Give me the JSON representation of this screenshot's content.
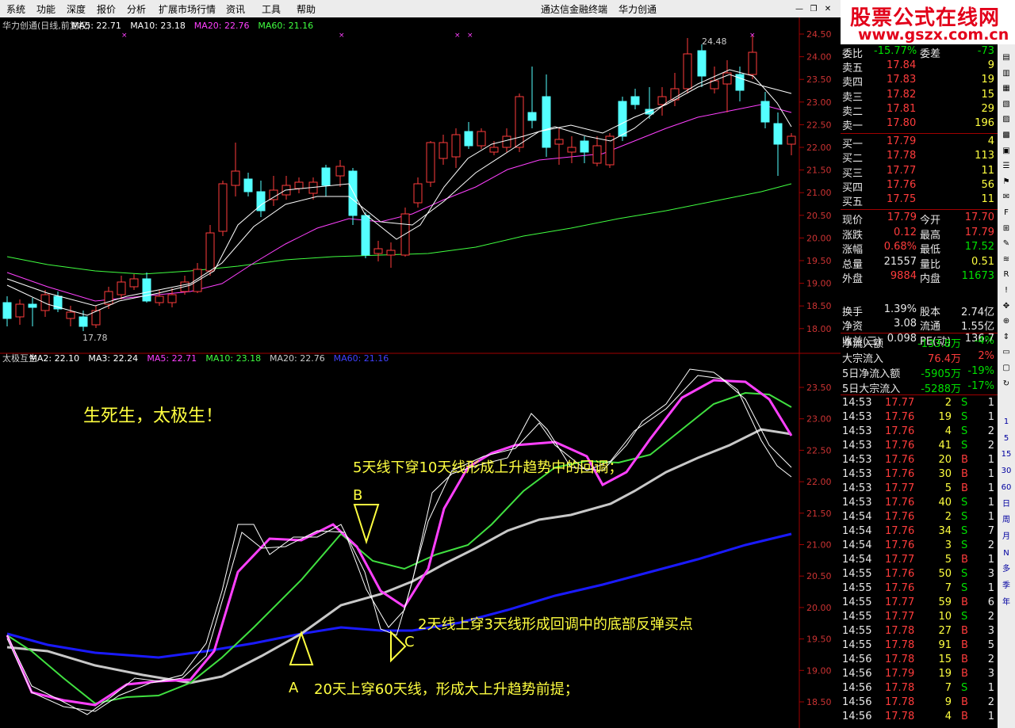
{
  "menu": {
    "items": [
      "系统",
      "功能",
      "深度",
      "报价",
      "分析",
      "扩展市场行情",
      "资讯",
      "工具",
      "帮助"
    ],
    "center_title": "通达信金融终端",
    "stock_name": "华力创通"
  },
  "brand": {
    "line1": "股票公式在线网",
    "line2": "www.gszx.com.cn"
  },
  "upper_chart": {
    "legend": [
      {
        "text": "华力创通(日线,前复权)",
        "color": "#d0d0d0"
      },
      {
        "text": "MA5: 22.71",
        "color": "#ffffff"
      },
      {
        "text": "MA10: 23.18",
        "color": "#ffffff"
      },
      {
        "text": "MA20: 22.76",
        "color": "#ff40ff"
      },
      {
        "text": "MA60: 21.16",
        "color": "#40ff40"
      }
    ],
    "max_label": "24.48",
    "min_label": "17.78",
    "y_ticks": [
      "24.50",
      "24.00",
      "23.50",
      "23.00",
      "22.50",
      "22.00",
      "21.50",
      "21.00",
      "20.50",
      "20.00",
      "19.50",
      "19.00",
      "18.50",
      "18.00"
    ]
  },
  "lower_chart": {
    "legend": [
      {
        "text": "太极互生",
        "color": "#d0d0d0"
      },
      {
        "text": "MA2: 22.10",
        "color": "#ffffff"
      },
      {
        "text": "MA3: 22.24",
        "color": "#ffffff"
      },
      {
        "text": "MA5: 22.71",
        "color": "#ff40ff"
      },
      {
        "text": "MA10: 23.18",
        "color": "#40ff40"
      },
      {
        "text": "MA20: 22.76",
        "color": "#c8c8c8"
      },
      {
        "text": "MA60: 21.16",
        "color": "#4040ff"
      }
    ],
    "y_ticks": [
      "23.50",
      "23.00",
      "22.50",
      "22.00",
      "21.50",
      "21.00",
      "20.50",
      "20.00",
      "19.50",
      "19.00",
      "18.50"
    ],
    "annotations": {
      "title": "生死生，太极生！",
      "a_text": "20天上穿60天线，形成大上升趋势前提；",
      "b_text": "5天线下穿10天线形成上升趋势中的回调；",
      "c_text": "2天线上穿3天线形成回调中的底部反弹买点",
      "label_a": "A",
      "label_b": "B",
      "label_c": "C"
    }
  },
  "quote": {
    "weibi": {
      "label": "委比",
      "value": "-15.77%",
      "label2": "委差",
      "value2": "-73"
    },
    "sell": [
      {
        "label": "卖五",
        "price": "17.84",
        "vol": "9"
      },
      {
        "label": "卖四",
        "price": "17.83",
        "vol": "19"
      },
      {
        "label": "卖三",
        "price": "17.82",
        "vol": "15"
      },
      {
        "label": "卖二",
        "price": "17.81",
        "vol": "29"
      },
      {
        "label": "卖一",
        "price": "17.80",
        "vol": "196"
      }
    ],
    "buy": [
      {
        "label": "买一",
        "price": "17.79",
        "vol": "4"
      },
      {
        "label": "买二",
        "price": "17.78",
        "vol": "113"
      },
      {
        "label": "买三",
        "price": "17.77",
        "vol": "11"
      },
      {
        "label": "买四",
        "price": "17.76",
        "vol": "56"
      },
      {
        "label": "买五",
        "price": "17.75",
        "vol": "11"
      }
    ],
    "stats": [
      {
        "l1": "现价",
        "v1": "17.79",
        "c1": "red",
        "l2": "今开",
        "v2": "17.70",
        "c2": "red"
      },
      {
        "l1": "涨跌",
        "v1": "0.12",
        "c1": "red",
        "l2": "最高",
        "v2": "17.79",
        "c2": "red"
      },
      {
        "l1": "涨幅",
        "v1": "0.68%",
        "c1": "red",
        "l2": "最低",
        "v2": "17.52",
        "c2": "green"
      },
      {
        "l1": "总量",
        "v1": "21557",
        "c1": "white",
        "l2": "量比",
        "v2": "0.51",
        "c2": "yellow"
      },
      {
        "l1": "外盘",
        "v1": "9884",
        "c1": "red",
        "l2": "内盘",
        "v2": "11673",
        "c2": "green"
      },
      {
        "l1": "换手",
        "v1": "1.39%",
        "c1": "white",
        "l2": "股本",
        "v2": "2.74亿",
        "c2": "white"
      },
      {
        "l1": "净资",
        "v1": "3.08",
        "c1": "white",
        "l2": "流通",
        "v2": "1.55亿",
        "c2": "white"
      },
      {
        "l1": "收益(三)",
        "v1": "0.098",
        "c1": "white",
        "l2": "PE(动)",
        "v2": "136.7",
        "c2": "white"
      }
    ],
    "flows": [
      {
        "label": "净流入额",
        "value": "-133.8万",
        "pct": "-4%"
      },
      {
        "label": "大宗流入",
        "value": "76.4万",
        "pct": "2%",
        "up": true
      },
      {
        "label": "5日净流入额",
        "value": "-5905万",
        "pct": "-19%"
      },
      {
        "label": "5日大宗流入",
        "value": "-5288万",
        "pct": "-17%"
      }
    ],
    "ticks": [
      {
        "t": "14:53",
        "p": "17.77",
        "v": "2",
        "d": "S",
        "n": "1"
      },
      {
        "t": "14:53",
        "p": "17.76",
        "v": "19",
        "d": "S",
        "n": "1"
      },
      {
        "t": "14:53",
        "p": "17.76",
        "v": "4",
        "d": "S",
        "n": "2"
      },
      {
        "t": "14:53",
        "p": "17.76",
        "v": "41",
        "d": "S",
        "n": "2"
      },
      {
        "t": "14:53",
        "p": "17.76",
        "v": "20",
        "d": "B",
        "n": "1"
      },
      {
        "t": "14:53",
        "p": "17.76",
        "v": "30",
        "d": "B",
        "n": "1"
      },
      {
        "t": "14:53",
        "p": "17.77",
        "v": "5",
        "d": "B",
        "n": "1"
      },
      {
        "t": "14:53",
        "p": "17.76",
        "v": "40",
        "d": "S",
        "n": "1"
      },
      {
        "t": "14:54",
        "p": "17.76",
        "v": "2",
        "d": "S",
        "n": "1"
      },
      {
        "t": "14:54",
        "p": "17.76",
        "v": "34",
        "d": "S",
        "n": "7"
      },
      {
        "t": "14:54",
        "p": "17.76",
        "v": "3",
        "d": "S",
        "n": "2"
      },
      {
        "t": "14:54",
        "p": "17.77",
        "v": "5",
        "d": "B",
        "n": "1"
      },
      {
        "t": "14:55",
        "p": "17.76",
        "v": "50",
        "d": "S",
        "n": "3"
      },
      {
        "t": "14:55",
        "p": "17.76",
        "v": "7",
        "d": "S",
        "n": "1"
      },
      {
        "t": "14:55",
        "p": "17.77",
        "v": "59",
        "d": "B",
        "n": "6"
      },
      {
        "t": "14:55",
        "p": "17.77",
        "v": "10",
        "d": "S",
        "n": "2"
      },
      {
        "t": "14:55",
        "p": "17.78",
        "v": "27",
        "d": "B",
        "n": "3"
      },
      {
        "t": "14:55",
        "p": "17.78",
        "v": "91",
        "d": "B",
        "n": "5"
      },
      {
        "t": "14:56",
        "p": "17.78",
        "v": "15",
        "d": "B",
        "n": "2"
      },
      {
        "t": "14:56",
        "p": "17.79",
        "v": "19",
        "d": "B",
        "n": "3"
      },
      {
        "t": "14:56",
        "p": "17.78",
        "v": "7",
        "d": "S",
        "n": "1"
      },
      {
        "t": "14:56",
        "p": "17.78",
        "v": "9",
        "d": "B",
        "n": "2"
      },
      {
        "t": "14:56",
        "p": "17.78",
        "v": "4",
        "d": "B",
        "n": "1"
      }
    ]
  },
  "sidebar": {
    "labels": [
      "1",
      "5",
      "15",
      "30",
      "60",
      "日",
      "周",
      "月",
      "N",
      "多",
      "季",
      "年"
    ]
  },
  "colors": {
    "up": "#ff3c3c",
    "down_fill": "#54ffff",
    "ma5": "#ffffff",
    "ma10": "#ffffff",
    "ma20": "#ff40ff",
    "ma60": "#40ff40"
  }
}
